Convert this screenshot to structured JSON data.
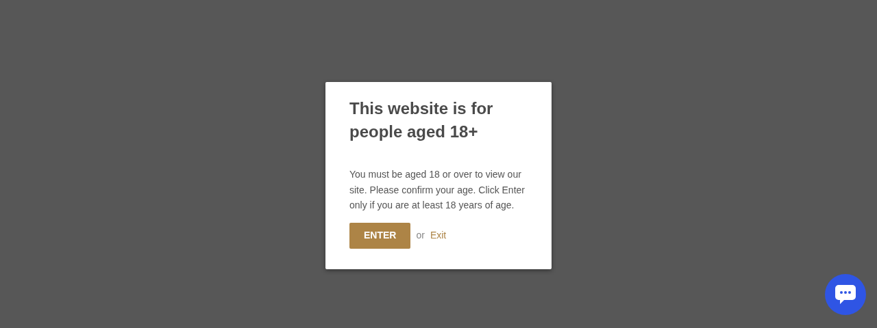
{
  "modal": {
    "title": "This website is for people aged 18+",
    "message": "You must be aged 18 or over to view our site. Please confirm your age. Click Enter only if you are at least 18 years of age.",
    "enter_button": "ENTER",
    "separator": "or",
    "exit_link": "Exit"
  },
  "chat_button": {
    "kind": "chat"
  }
}
